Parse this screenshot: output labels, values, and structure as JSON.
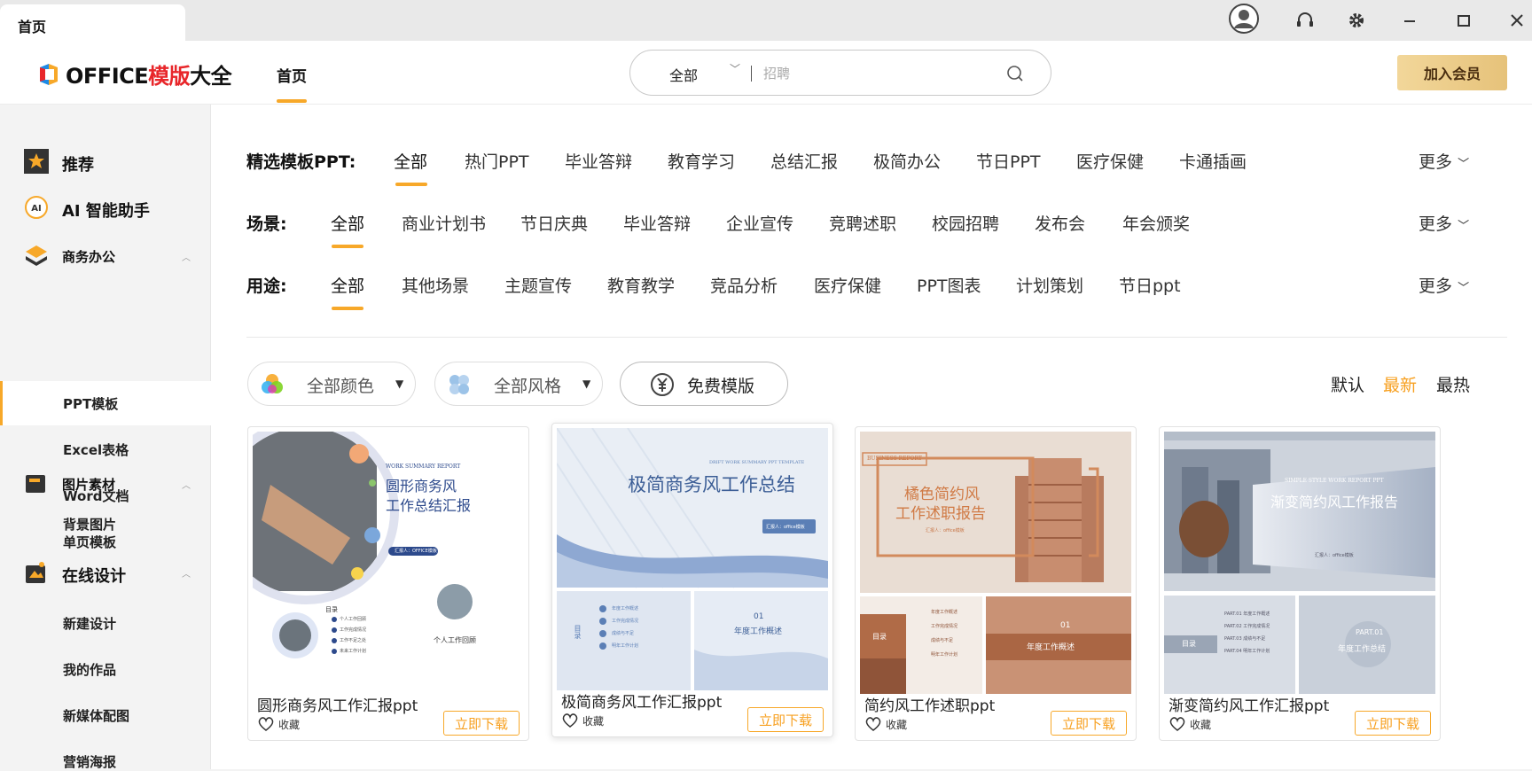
{
  "window": {
    "tab_title": "首页"
  },
  "header": {
    "logo_prefix": "OFFICE",
    "logo_red": "模版",
    "logo_suffix": "大全",
    "nav_home": "首页",
    "vip_button": "加入会员"
  },
  "search": {
    "category": "全部",
    "placeholder": "招聘",
    "value": ""
  },
  "sidebar": {
    "recommend": "推荐",
    "ai": "AI 智能助手",
    "business": "商务办公",
    "business_items": [
      "PPT模板",
      "Excel表格",
      "Word文档",
      "单页模板"
    ],
    "images": "图片素材",
    "image_items": [
      "背景图片"
    ],
    "design": "在线设计",
    "design_items": [
      "新建设计",
      "我的作品",
      "新媒体配图",
      "营销海报"
    ]
  },
  "filters": {
    "row1": {
      "label": "精选模板PPT:",
      "items": [
        "全部",
        "热门PPT",
        "毕业答辩",
        "教育学习",
        "总结汇报",
        "极简办公",
        "节日PPT",
        "医疗保健",
        "卡通插画"
      ],
      "more": "更多"
    },
    "row2": {
      "label": "场景:",
      "items": [
        "全部",
        "商业计划书",
        "节日庆典",
        "毕业答辩",
        "企业宣传",
        "竞聘述职",
        "校园招聘",
        "发布会",
        "年会颁奖"
      ],
      "more": "更多"
    },
    "row3": {
      "label": "用途:",
      "items": [
        "全部",
        "其他场景",
        "主题宣传",
        "教育教学",
        "竞品分析",
        "医疗保健",
        "PPT图表",
        "计划策划",
        "节日ppt"
      ],
      "more": "更多"
    }
  },
  "toolbar": {
    "color": "全部颜色",
    "style": "全部风格",
    "free": "免费模版",
    "sort": [
      "默认",
      "最新",
      "最热"
    ],
    "sort_active": "最新",
    "accent": "#f7a829"
  },
  "cards": [
    {
      "title": "圆形商务风工作汇报ppt",
      "fav": "收藏",
      "download": "立即下载",
      "thumb": {
        "en": "WORK SUMMARY REPORT",
        "h1": "圆形商务风",
        "h2": "工作总结汇报",
        "btn": "汇报人：OFFICE模板",
        "toc": "目录",
        "toc_items": [
          "个人工作回顾",
          "工作完成情况",
          "工作不足之处",
          "未来工作计划"
        ],
        "sub": "个人工作回顾"
      }
    },
    {
      "title": "极简商务风工作汇报ppt",
      "fav": "收藏",
      "download": "立即下载",
      "thumb": {
        "en": "DRIFT WORK SUMMARY PPT TEMPLATE",
        "h1": "极简商务风工作总结",
        "btn": "汇报人：office模板",
        "toc": "目录",
        "toc_items": [
          "年度工作概述",
          "工作完成情况",
          "成绩与不足",
          "明年工作计划"
        ],
        "part": "01",
        "sub": "年度工作概述"
      }
    },
    {
      "title": "简约风工作述职ppt",
      "fav": "收藏",
      "download": "立即下载",
      "thumb": {
        "en": "BUSINESS REPORT",
        "h1": "橘色简约风",
        "h2": "工作述职报告",
        "btn": "汇报人：office模板",
        "toc": "目录",
        "toc_items": [
          "年度工作概述",
          "工作完成情况",
          "成绩与不足",
          "明年工作计划"
        ],
        "part": "01",
        "sub": "年度工作概述"
      }
    },
    {
      "title": "渐变简约风工作汇报ppt",
      "fav": "收藏",
      "download": "立即下载",
      "thumb": {
        "en": "SIMPLE STYLE WORK REPORT PPT",
        "h1": "渐变简约风工作报告",
        "btn": "汇报人：office模板",
        "toc": "目录",
        "toc_items": [
          "PART.01 年度工作概述",
          "PART.02 工作完成情况",
          "PART.03 成绩与不足",
          "PART.04 明年工作计划"
        ],
        "part": "PART.01",
        "sub": "年度工作总结"
      }
    }
  ]
}
